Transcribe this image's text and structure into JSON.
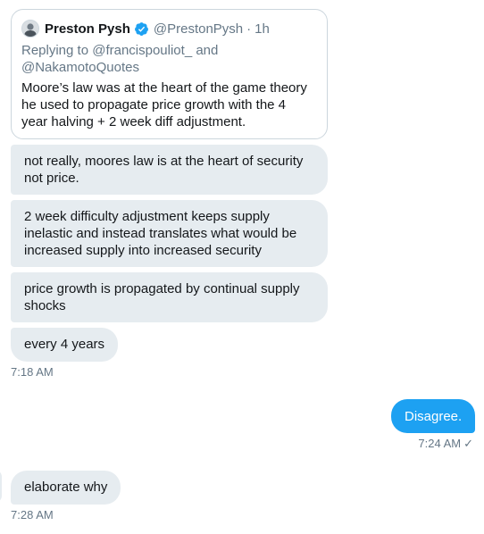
{
  "quote": {
    "name": "Preston Pysh",
    "handle": "@PrestonPysh",
    "dot": "·",
    "time": "1h",
    "reply_line1": "Replying to @francispouliot_ and",
    "reply_line2": "@NakamotoQuotes",
    "text_line1": "Moore’s law was at the heart of the game theory",
    "text_line2": "he used to propagate price growth with the 4",
    "text_line3": "year halving + 2 week diff adjustment."
  },
  "messages": {
    "m1_line1": "not really, moores law is at the heart of security",
    "m1_line2": "not price.",
    "m2_line1": "2 week difficulty adjustment keeps supply",
    "m2_line2": "inelastic and instead translates what would be",
    "m2_line3": "increased supply into increased security",
    "m3_line1": "price growth is propagated by continual supply",
    "m3_line2": "shocks",
    "m4": "every 4 years",
    "time1": "7:18 AM",
    "sent": "Disagree.",
    "time2": "7:24 AM",
    "sent_check": "✓",
    "m5": "elaborate why",
    "time3": "7:28 AM"
  },
  "colors": {
    "incoming_bubble": "#e6ecf0",
    "outgoing_bubble": "#1da1f2",
    "verified": "#1da1f2",
    "secondary_text": "#657786"
  },
  "icons": {
    "avatar": "avatar-icon",
    "verified": "verified-badge-icon",
    "read_receipt": "check-icon"
  }
}
